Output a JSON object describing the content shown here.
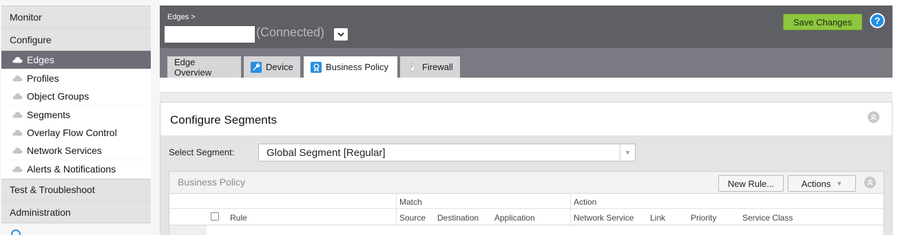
{
  "sidebar": {
    "sections": [
      {
        "label": "Monitor"
      },
      {
        "label": "Configure"
      },
      {
        "label": "Test & Troubleshoot"
      },
      {
        "label": "Administration"
      }
    ],
    "items": [
      {
        "label": "Edges",
        "active": true
      },
      {
        "label": "Profiles"
      },
      {
        "label": "Object Groups"
      },
      {
        "label": "Segments"
      },
      {
        "label": "Overlay Flow Control"
      },
      {
        "label": "Network Services"
      },
      {
        "label": "Alerts & Notifications"
      }
    ]
  },
  "header": {
    "breadcrumb": "Edges >",
    "edge_status": "(Connected)",
    "save_label": "Save Changes",
    "help_label": "?"
  },
  "tabs": [
    {
      "label": "Edge Overview",
      "icon": "none"
    },
    {
      "label": "Device",
      "icon": "wrench-icon"
    },
    {
      "label": "Business Policy",
      "icon": "badge-icon",
      "active": true
    },
    {
      "label": "Firewall",
      "icon": "flame-icon"
    }
  ],
  "panel": {
    "title": "Configure Segments",
    "select_label": "Select Segment:",
    "select_value": "Global Segment [Regular]"
  },
  "business_policy": {
    "title": "Business Policy",
    "new_rule_label": "New Rule...",
    "actions_label": "Actions",
    "groups": {
      "match": "Match",
      "action": "Action"
    },
    "columns": {
      "rule": "Rule",
      "source": "Source",
      "destination": "Destination",
      "application": "Application",
      "network_service": "Network Service",
      "link": "Link",
      "priority": "Priority",
      "service_class": "Service Class"
    }
  },
  "colors": {
    "save_green": "#8dc63f",
    "help_blue": "#1e8fe6",
    "active_sidebar": "#6d6d78",
    "topbar": "#5f5f66"
  }
}
